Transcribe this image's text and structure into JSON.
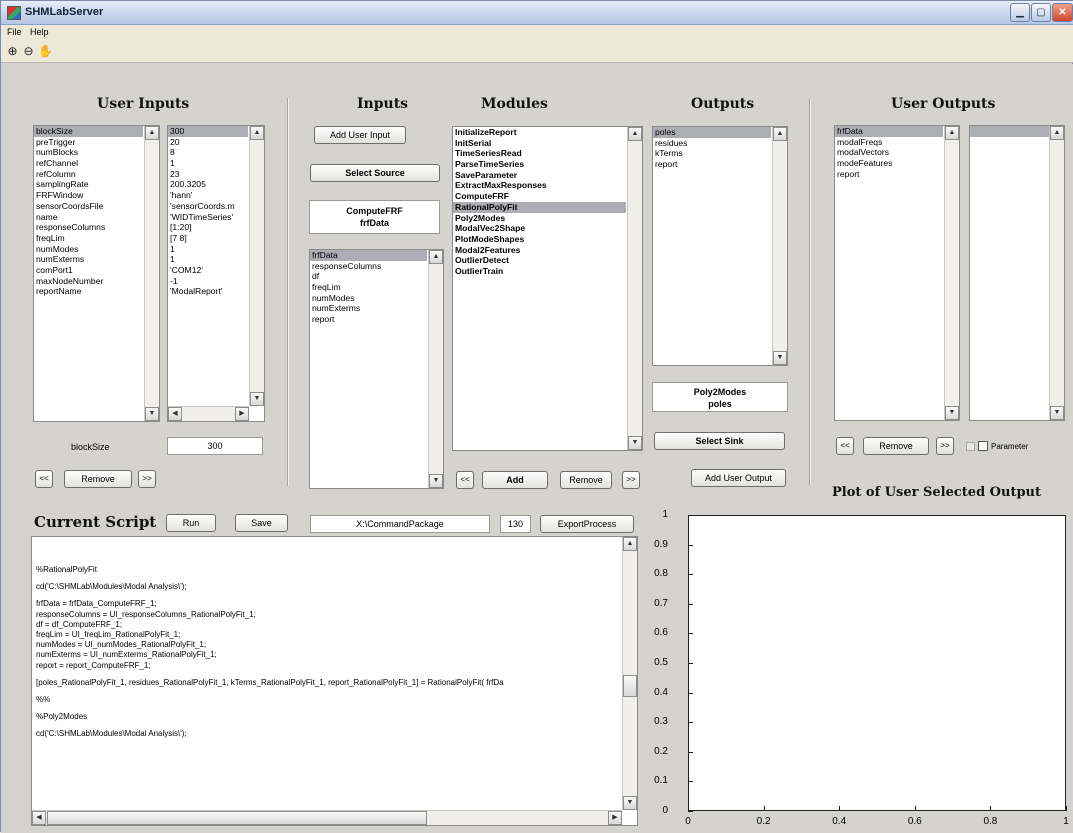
{
  "window": {
    "title": "SHMLabServer",
    "min": "▁",
    "max": "▢",
    "close": "✕"
  },
  "menu": [
    "File",
    "Help"
  ],
  "toolbar": {
    "zoom_in": "zoom-in-icon",
    "zoom_out": "zoom-out-icon",
    "pan": "pan-hand-icon"
  },
  "user_inputs": {
    "header": "User Inputs",
    "names": [
      "blockSize",
      "preTrigger",
      "numBlocks",
      "refChannel",
      "refColumn",
      "samplingRate",
      "FRFWindow",
      "sensorCoordsFile",
      "name",
      "responseColumns",
      "freqLim",
      "numModes",
      "numExterms",
      "comPort1",
      "maxNodeNumber",
      "reportName"
    ],
    "values": [
      "300",
      "20",
      "8",
      "1",
      "23",
      "200.3205",
      "'hann'",
      "'sensorCoords.m",
      "'WIDTimeSeries'",
      "[1:20]",
      "[7 8]",
      "1",
      "1",
      "'COM12'",
      "-1",
      "'ModalReport'"
    ],
    "selected_label": "blockSize",
    "selected_value": "300",
    "prev": "<<",
    "remove": "Remove",
    "next": ">>"
  },
  "inputs": {
    "header": "Inputs",
    "add_user_input": "Add User Input",
    "select_source": "Select Source",
    "source_line1": "ComputeFRF",
    "source_line2": "frfData",
    "items": [
      "frfData",
      "responseColumns",
      "df",
      "freqLim",
      "numModes",
      "numExterms",
      "report"
    ]
  },
  "modules": {
    "header": "Modules",
    "items": [
      "InitializeReport",
      "InitSerial",
      "TimeSeriesRead",
      "ParseTimeSeries",
      "SaveParameter",
      "ExtractMaxResponses",
      "ComputeFRF",
      "RationalPolyFit",
      "Poly2Modes",
      "ModalVec2Shape",
      "PlotModeShapes",
      "Modal2Features",
      "OutlierDetect",
      "OutlierTrain"
    ],
    "selected": "RationalPolyFit",
    "prev": "<<",
    "add": "Add",
    "remove": "Remove",
    "next": ">>"
  },
  "outputs": {
    "header": "Outputs",
    "items": [
      "poles",
      "residues",
      "kTerms",
      "report"
    ],
    "sink_line1": "Poly2Modes",
    "sink_line2": "poles",
    "select_sink": "Select Sink",
    "add_user_output": "Add User Output"
  },
  "user_outputs": {
    "header": "User Outputs",
    "items": [
      "frfData",
      "modalFreqs",
      "modalVectors",
      "modeFeatures",
      "report"
    ],
    "prev": "<<",
    "remove": "Remove",
    "next": ">>",
    "parameter_label": "Parameter"
  },
  "script": {
    "header": "Current Script",
    "run": "Run",
    "save": "Save",
    "path": "X:\\CommandPackage",
    "number": "130",
    "export": "ExportProcess",
    "lines": [
      "%RationalPolyFit",
      "",
      "cd('C:\\SHMLab\\Modules\\Modal Analysis\\');",
      "",
      "frfData = frfData_ComputeFRF_1;",
      "responseColumns = UI_responseColumns_RationalPolyFit_1;",
      "df = df_ComputeFRF_1;",
      "freqLim = UI_freqLim_RationalPolyFit_1;",
      "numModes = UI_numModes_RationalPolyFit_1;",
      "numExterms = UI_numExterms_RationalPolyFit_1;",
      "report = report_ComputeFRF_1;",
      "",
      "[poles_RationalPolyFit_1, residues_RationalPolyFit_1, kTerms_RationalPolyFit_1, report_RationalPolyFit_1] = RationalPolyFit( frfDa",
      "",
      "%%",
      "",
      "%Poly2Modes",
      "",
      "cd('C:\\SHMLab\\Modules\\Modal Analysis\\');"
    ]
  },
  "plot": {
    "title": "Plot of User Selected Output",
    "yticks": [
      "0",
      "0.1",
      "0.2",
      "0.3",
      "0.4",
      "0.5",
      "0.6",
      "0.7",
      "0.8",
      "0.9",
      "1"
    ],
    "xticks": [
      "0",
      "0.2",
      "0.4",
      "0.6",
      "0.8",
      "1"
    ]
  }
}
